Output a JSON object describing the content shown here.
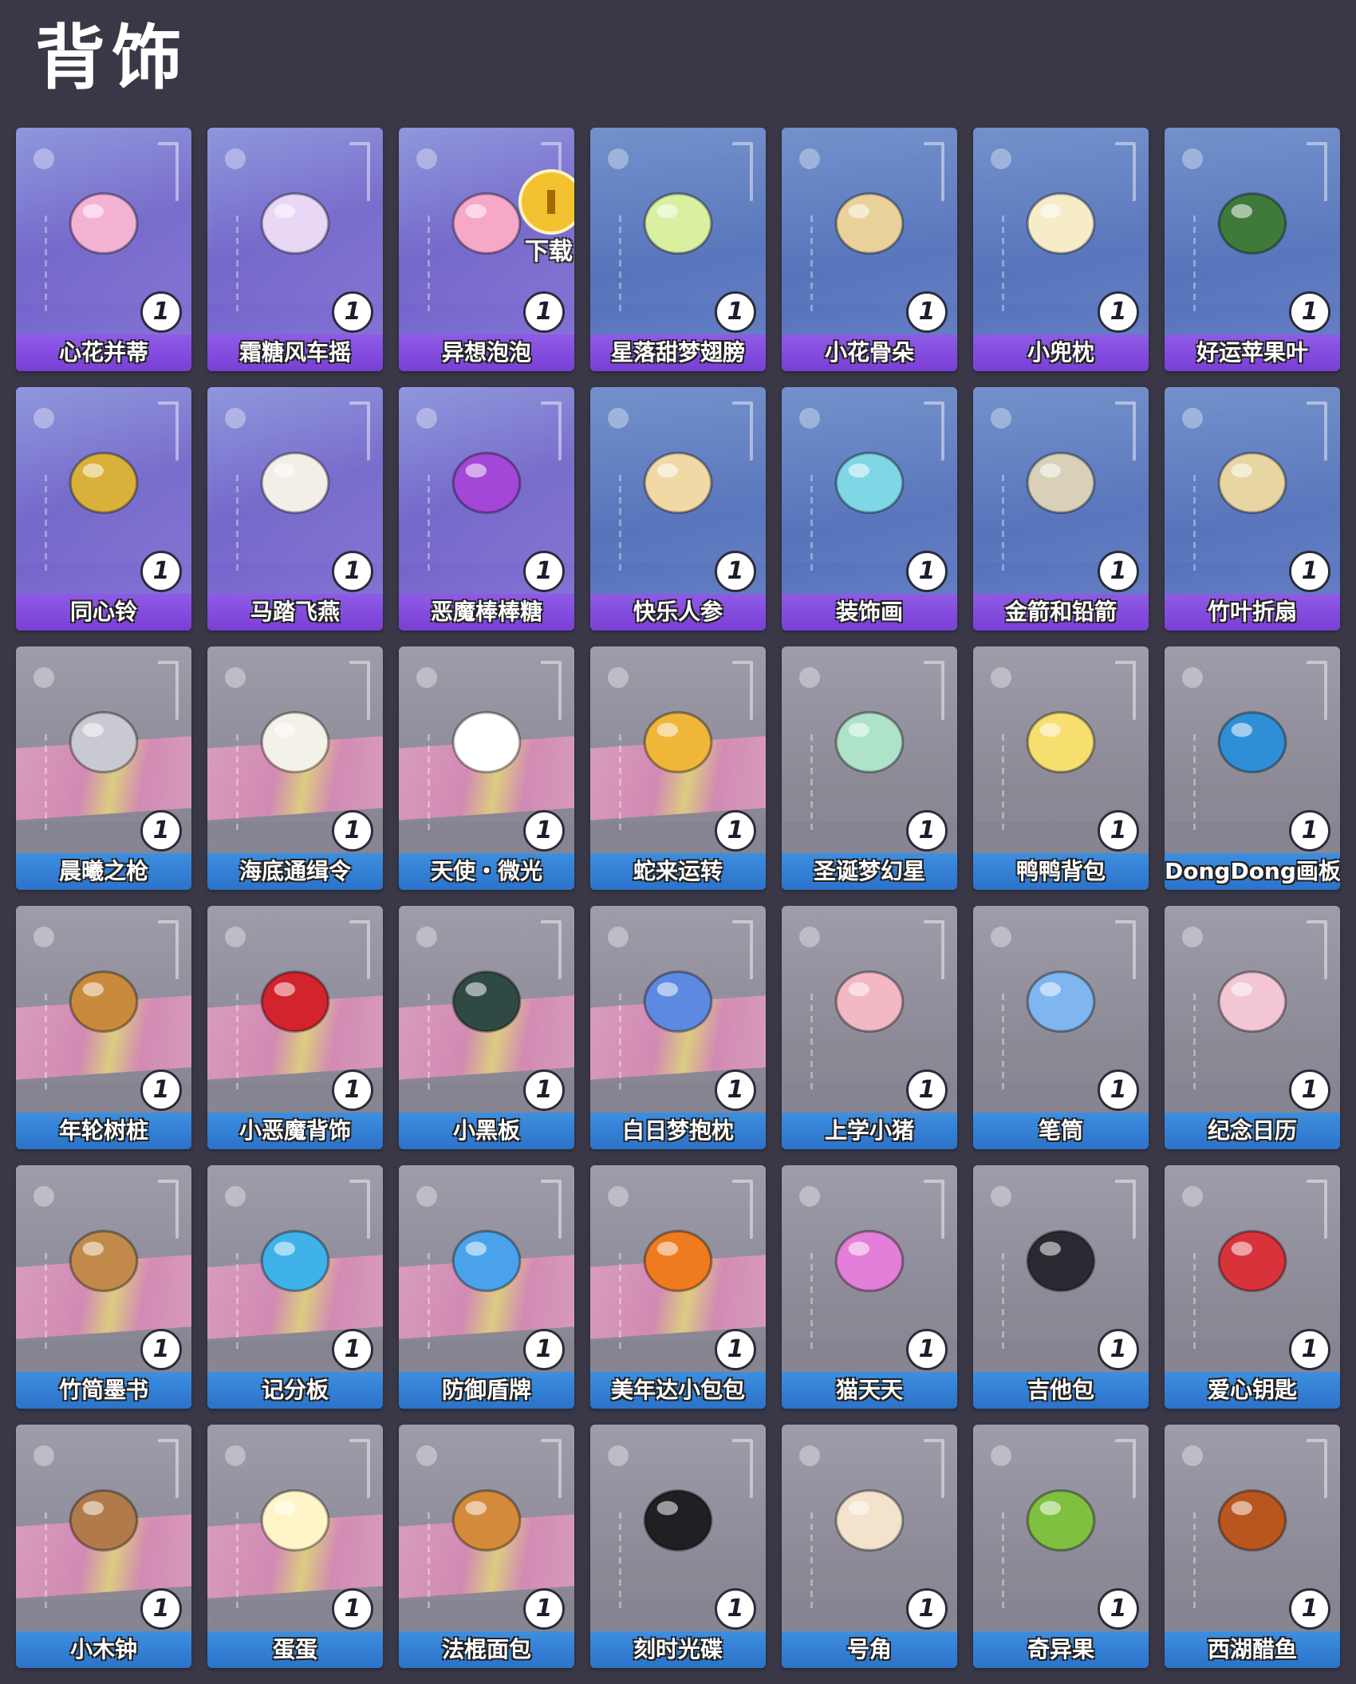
{
  "page": {
    "title": "背饰"
  },
  "overlay": {
    "download_label": "下载"
  },
  "items": [
    {
      "name": "心花并蒂",
      "count": "1",
      "theme": "purple",
      "icon": "flower-ribbon-icon",
      "color": "#f5b3d3"
    },
    {
      "name": "霜糖风车摇",
      "count": "1",
      "theme": "purple",
      "icon": "pinwheel-icon",
      "color": "#e9d8f5"
    },
    {
      "name": "异想泡泡",
      "count": "1",
      "theme": "purple",
      "icon": "balloon-bubbles-icon",
      "color": "#f7a8c8"
    },
    {
      "name": "星落甜梦翅膀",
      "count": "1",
      "theme": "blue",
      "icon": "butterfly-wings-icon",
      "color": "#d9f0a0"
    },
    {
      "name": "小花骨朵",
      "count": "1",
      "theme": "blue",
      "icon": "bone-ornament-icon",
      "color": "#e8d29a"
    },
    {
      "name": "小兜枕",
      "count": "1",
      "theme": "blue",
      "icon": "mushroom-pillow-icon",
      "color": "#f6edc8"
    },
    {
      "name": "好运苹果叶",
      "count": "1",
      "theme": "blue",
      "icon": "apple-leaf-icon",
      "color": "#3f7a3a"
    },
    {
      "name": "同心铃",
      "count": "1",
      "theme": "purple",
      "icon": "bell-bow-icon",
      "color": "#d9b13a"
    },
    {
      "name": "马踏飞燕",
      "count": "1",
      "theme": "purple",
      "icon": "horse-toy-icon",
      "color": "#f3efe6"
    },
    {
      "name": "恶魔棒棒糖",
      "count": "1",
      "theme": "purple",
      "icon": "devil-lollipop-icon",
      "color": "#a347d8"
    },
    {
      "name": "快乐人参",
      "count": "1",
      "theme": "blue",
      "icon": "ginseng-icon",
      "color": "#f1d9a6"
    },
    {
      "name": "装饰画",
      "count": "1",
      "theme": "blue",
      "icon": "picture-frame-icon",
      "color": "#7fd7e6"
    },
    {
      "name": "金箭和铅箭",
      "count": "1",
      "theme": "blue",
      "icon": "bow-arrow-icon",
      "color": "#d8d0b8"
    },
    {
      "name": "竹叶折扇",
      "count": "1",
      "theme": "blue",
      "icon": "folding-fan-icon",
      "color": "#e8d6a2"
    },
    {
      "name": "晨曦之枪",
      "count": "1",
      "theme": "gray",
      "icon": "spear-icon",
      "color": "#c9c9d3"
    },
    {
      "name": "海底通缉令",
      "count": "1",
      "theme": "gray",
      "icon": "wanted-scroll-icon",
      "color": "#f4f1e8"
    },
    {
      "name": "天使・微光",
      "count": "1",
      "theme": "gray",
      "icon": "angel-wings-icon",
      "color": "#ffffff"
    },
    {
      "name": "蛇来运转",
      "count": "1",
      "theme": "gray",
      "icon": "gold-ingot-icon",
      "color": "#f0b63a"
    },
    {
      "name": "圣诞梦幻星",
      "count": "1",
      "theme": "gray",
      "icon": "star-bottle-icon",
      "color": "#aee3c9"
    },
    {
      "name": "鸭鸭背包",
      "count": "1",
      "theme": "gray",
      "icon": "duck-backpack-icon",
      "color": "#f6df6e"
    },
    {
      "name": "DongDong画板",
      "count": "1",
      "theme": "gray",
      "icon": "clipboard-icon",
      "color": "#2f8fd6"
    },
    {
      "name": "年轮树桩",
      "count": "1",
      "theme": "gray",
      "icon": "tree-stump-icon",
      "color": "#c98a3e"
    },
    {
      "name": "小恶魔背饰",
      "count": "1",
      "theme": "gray",
      "icon": "devil-tail-icon",
      "color": "#d3232d"
    },
    {
      "name": "小黑板",
      "count": "1",
      "theme": "gray",
      "icon": "chalkboard-icon",
      "color": "#2f4a44"
    },
    {
      "name": "白日梦抱枕",
      "count": "1",
      "theme": "gray",
      "icon": "star-pillow-icon",
      "color": "#5d8ae0"
    },
    {
      "name": "上学小猪",
      "count": "1",
      "theme": "gray",
      "icon": "pig-icon",
      "color": "#f2b8c4"
    },
    {
      "name": "笔筒",
      "count": "1",
      "theme": "gray",
      "icon": "pencil-cup-icon",
      "color": "#7fb6f0"
    },
    {
      "name": "纪念日历",
      "count": "1",
      "theme": "gray",
      "icon": "calendar-icon",
      "color": "#f3c6d4"
    },
    {
      "name": "竹简墨书",
      "count": "1",
      "theme": "gray",
      "icon": "bamboo-scroll-icon",
      "color": "#c18a4a"
    },
    {
      "name": "记分板",
      "count": "1",
      "theme": "gray",
      "icon": "scoreboard-icon",
      "color": "#3fb2ea"
    },
    {
      "name": "防御盾牌",
      "count": "1",
      "theme": "gray",
      "icon": "shield-icon",
      "color": "#4aa3ea"
    },
    {
      "name": "美年达小包包",
      "count": "1",
      "theme": "gray",
      "icon": "orange-bag-icon",
      "color": "#f07a1e"
    },
    {
      "name": "猫天天",
      "count": "1",
      "theme": "gray",
      "icon": "cat-flower-icon",
      "color": "#e37fd8"
    },
    {
      "name": "吉他包",
      "count": "1",
      "theme": "gray",
      "icon": "guitar-case-icon",
      "color": "#2a2a33"
    },
    {
      "name": "爱心钥匙",
      "count": "1",
      "theme": "gray",
      "icon": "heart-key-icon",
      "color": "#d8323b"
    },
    {
      "name": "小木钟",
      "count": "1",
      "theme": "gray",
      "icon": "wooden-clock-icon",
      "color": "#b07a4a"
    },
    {
      "name": "蛋蛋",
      "count": "1",
      "theme": "gray",
      "icon": "egg-icon",
      "color": "#fff5c8"
    },
    {
      "name": "法棍面包",
      "count": "1",
      "theme": "gray",
      "icon": "baguette-icon",
      "color": "#d38a3a"
    },
    {
      "name": "刻时光碟",
      "count": "1",
      "theme": "gray",
      "icon": "vinyl-disc-icon",
      "color": "#1f1f24"
    },
    {
      "name": "号角",
      "count": "1",
      "theme": "gray",
      "icon": "horn-icon",
      "color": "#f3e2cc"
    },
    {
      "name": "奇异果",
      "count": "1",
      "theme": "gray",
      "icon": "kiwi-icon",
      "color": "#7fc040"
    },
    {
      "name": "西湖醋鱼",
      "count": "1",
      "theme": "gray",
      "icon": "braised-fish-icon",
      "color": "#b9551e"
    }
  ]
}
